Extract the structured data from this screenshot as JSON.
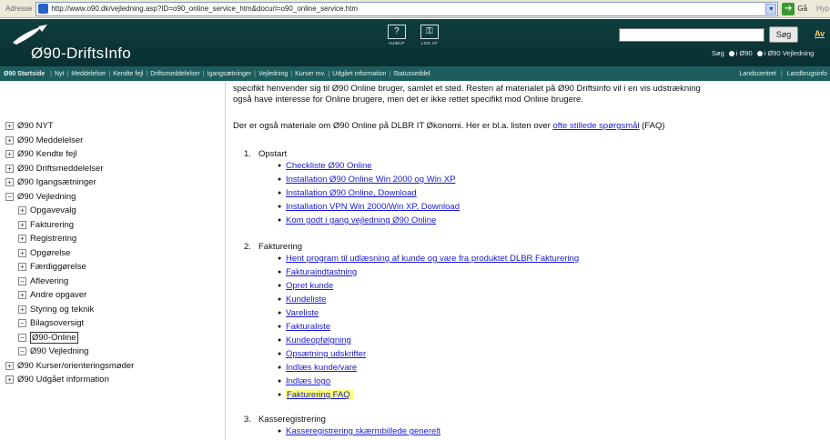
{
  "browser": {
    "address_label": "Adresse",
    "url": "http://www.o90.dk/vejledning.asp?ID=o90_online_service_htm&docurl=o90_online_service.htm",
    "go_label": "Gå",
    "extra": "Hyp"
  },
  "header": {
    "title": "Ø90-DriftsInfo",
    "help_label": "HJÆLP",
    "help_icon": "?",
    "logout_label": "LOG AF",
    "search_button": "Søg",
    "extra_link": "Av",
    "search_scope": {
      "label": "Søg",
      "option1": "i Ø90",
      "option2": "i Ø90 Vejledning"
    }
  },
  "nav": {
    "home": "Ø90 Startside",
    "items": [
      "Nyt",
      "Meddelelser",
      "Kendte fejl",
      "Driftsmeddelelser",
      "Igangsætninger",
      "Vejledning",
      "Kurser mv.",
      "Udgået information",
      "Statusseddel"
    ],
    "right_items": [
      "Landscentret",
      "Landbrugsinfo"
    ]
  },
  "tree": {
    "items": [
      {
        "label": "Ø90 NYT",
        "toggle": "+",
        "level": 0
      },
      {
        "label": "Ø90 Meddelelser",
        "toggle": "+",
        "level": 0
      },
      {
        "label": "Ø90 Kendte fejl",
        "toggle": "+",
        "level": 0
      },
      {
        "label": "Ø90 Driftsmeddelelser",
        "toggle": "+",
        "level": 0
      },
      {
        "label": "Ø90 Igangsætninger",
        "toggle": "+",
        "level": 0
      },
      {
        "label": "Ø90 Vejledning",
        "toggle": "−",
        "level": 0
      },
      {
        "label": "Opgavevalg",
        "toggle": "+",
        "level": 1
      },
      {
        "label": "Fakturering",
        "toggle": "+",
        "level": 1
      },
      {
        "label": "Registrering",
        "toggle": "+",
        "level": 1
      },
      {
        "label": "Opgørelse",
        "toggle": "+",
        "level": 1
      },
      {
        "label": "Færdiggørelse",
        "toggle": "+",
        "level": 1
      },
      {
        "label": "Aflevering",
        "toggle": "−",
        "level": 1
      },
      {
        "label": "Andre opgaver",
        "toggle": "+",
        "level": 1
      },
      {
        "label": "Styring og teknik",
        "toggle": "+",
        "level": 1
      },
      {
        "label": "Bilagsoversigt",
        "toggle": "−",
        "level": 1
      },
      {
        "label": "Ø90-Online",
        "toggle": "−",
        "level": 1
      },
      {
        "label": "Ø90 Vejledning",
        "toggle": "−",
        "level": 1
      },
      {
        "label": "Ø90 Kurser/orienteringsmøder",
        "toggle": "+",
        "level": 0
      },
      {
        "label": "Ø90 Udgået information",
        "toggle": "+",
        "level": 0
      }
    ]
  },
  "main": {
    "intro_line1": "specifikt henvender sig til Ø90 Online bruger, samlet et sted. Resten af materialet på Ø90 Driftsinfo vil i en vis udstrækning",
    "intro_line2": "også have interesse for Online brugere, men det er ikke rettet specifikt mod Online brugere.",
    "faq_text_before": "Der er også materiale om Ø90 Online på DLBR IT Økonomi. Her er bl.a. listen over ",
    "faq_link": "ofte stillede spørgsmål",
    "faq_text_after": " (FAQ)",
    "sections": [
      {
        "num": "1.",
        "title": "Opstart",
        "links": [
          "Checkliste Ø90 Online",
          "Installation Ø90 Online Win 2000 og Win XP",
          "Installation Ø90 Online, Download",
          "Installation VPN Win 2000/Win XP, Download",
          "Kom godt i gang vejledning Ø90 Online"
        ]
      },
      {
        "num": "2.",
        "title": "Fakturering",
        "links": [
          "Hent program til udlæsning af kunde og vare fra produktet DLBR Fakturering",
          "Fakturaindtastning",
          "Opret kunde",
          "Kundeliste",
          "Vareliste",
          "Fakturaliste",
          "Kundeopfølgning",
          "Opsætning udskrifter",
          "Indlæs kunde/vare",
          "Indlæs logo",
          "Fakturering FAQ"
        ]
      },
      {
        "num": "3.",
        "title": "Kasseregistrering",
        "links": [
          "Kasseregistrering skærmbillede generelt"
        ]
      }
    ]
  },
  "colors": {
    "banner": "#0f3e3e",
    "navbar": "#1d5d5e",
    "link": "#1a1ad6",
    "highlight": "#ffff7a"
  }
}
